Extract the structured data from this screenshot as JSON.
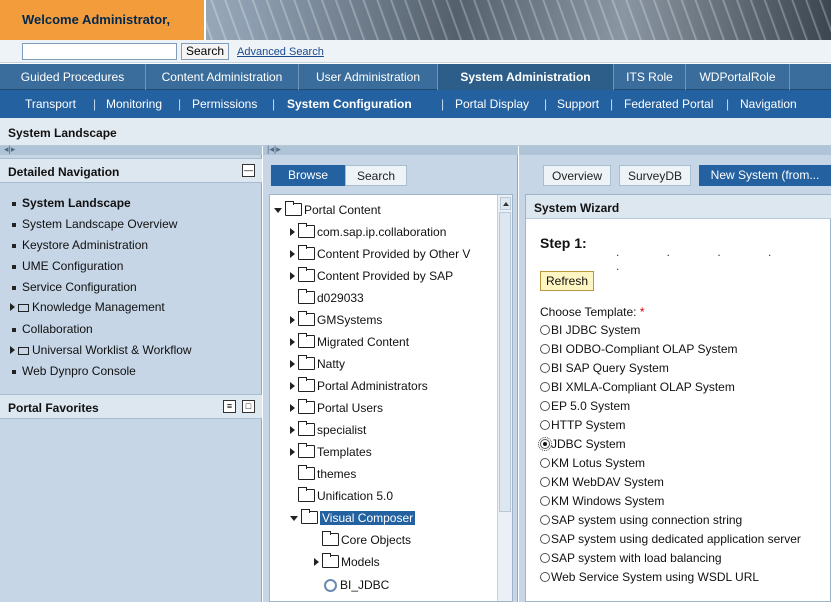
{
  "header": {
    "welcome": "Welcome Administrator,"
  },
  "search": {
    "value": "",
    "button": "Search",
    "advanced": "Advanced Search"
  },
  "nav1": {
    "tabs": [
      {
        "label": "Guided Procedures"
      },
      {
        "label": "Content Administration"
      },
      {
        "label": "User Administration"
      },
      {
        "label": "System Administration",
        "active": true
      },
      {
        "label": "ITS Role"
      },
      {
        "label": "WDPortalRole"
      }
    ]
  },
  "nav2": {
    "items": [
      {
        "label": "Transport"
      },
      {
        "label": "Monitoring"
      },
      {
        "label": "Permissions"
      },
      {
        "label": "System Configuration",
        "active": true
      },
      {
        "label": "Portal Display"
      },
      {
        "label": "Support"
      },
      {
        "label": "Federated Portal"
      },
      {
        "label": "Navigation"
      }
    ],
    "separator": "|"
  },
  "page": {
    "title": "System Landscape"
  },
  "detailed_nav": {
    "title": "Detailed Navigation",
    "items": [
      {
        "label": "System Landscape",
        "active": true
      },
      {
        "label": "System Landscape Overview"
      },
      {
        "label": "Keystore Administration"
      },
      {
        "label": "UME Configuration"
      },
      {
        "label": "Service Configuration"
      },
      {
        "label": "Knowledge Management",
        "folder": true
      },
      {
        "label": "Collaboration"
      },
      {
        "label": "Universal Worklist & Workflow",
        "folder": true
      },
      {
        "label": "Web Dynpro Console"
      }
    ]
  },
  "portal_favorites": {
    "title": "Portal Favorites"
  },
  "browser": {
    "tabs": [
      {
        "label": "Browse",
        "active": true
      },
      {
        "label": "Search"
      }
    ],
    "tree": [
      {
        "label": "Portal Content"
      },
      {
        "label": "com.sap.ip.collaboration"
      },
      {
        "label": "Content Provided by Other V"
      },
      {
        "label": "Content Provided by SAP"
      },
      {
        "label": "d029033"
      },
      {
        "label": "GMSystems"
      },
      {
        "label": "Migrated Content"
      },
      {
        "label": "Natty"
      },
      {
        "label": "Portal Administrators"
      },
      {
        "label": "Portal Users"
      },
      {
        "label": "specialist"
      },
      {
        "label": "Templates"
      },
      {
        "label": "themes"
      },
      {
        "label": "Unification 5.0"
      },
      {
        "label": "Visual Composer",
        "selected": true
      },
      {
        "label": "Core Objects"
      },
      {
        "label": "Models"
      },
      {
        "label": "BI_JDBC"
      }
    ]
  },
  "right_tabs": [
    {
      "label": "Overview"
    },
    {
      "label": "SurveyDB"
    },
    {
      "label": "New System (from...",
      "active": true
    }
  ],
  "wizard": {
    "title": "System Wizard",
    "step": "Step 1:",
    "refresh": "Refresh",
    "choose_label": "Choose Template:",
    "required_mark": "*",
    "templates": [
      {
        "label": "BI JDBC System"
      },
      {
        "label": "BI ODBO-Compliant OLAP System"
      },
      {
        "label": "BI SAP Query System"
      },
      {
        "label": "BI XMLA-Compliant OLAP System"
      },
      {
        "label": "EP 5.0 System"
      },
      {
        "label": "HTTP System"
      },
      {
        "label": "JDBC System",
        "selected": true
      },
      {
        "label": "KM Lotus System"
      },
      {
        "label": "KM WebDAV System"
      },
      {
        "label": "KM Windows System"
      },
      {
        "label": "SAP system using connection string"
      },
      {
        "label": "SAP system using dedicated application server"
      },
      {
        "label": "SAP system with load balancing"
      },
      {
        "label": "Web Service System using WSDL URL"
      }
    ]
  },
  "colors": {
    "accent": "#f39c3b",
    "nav_primary": "#3a6d9b",
    "nav_secondary": "#2461a0",
    "panel": "#c6d6e6"
  }
}
